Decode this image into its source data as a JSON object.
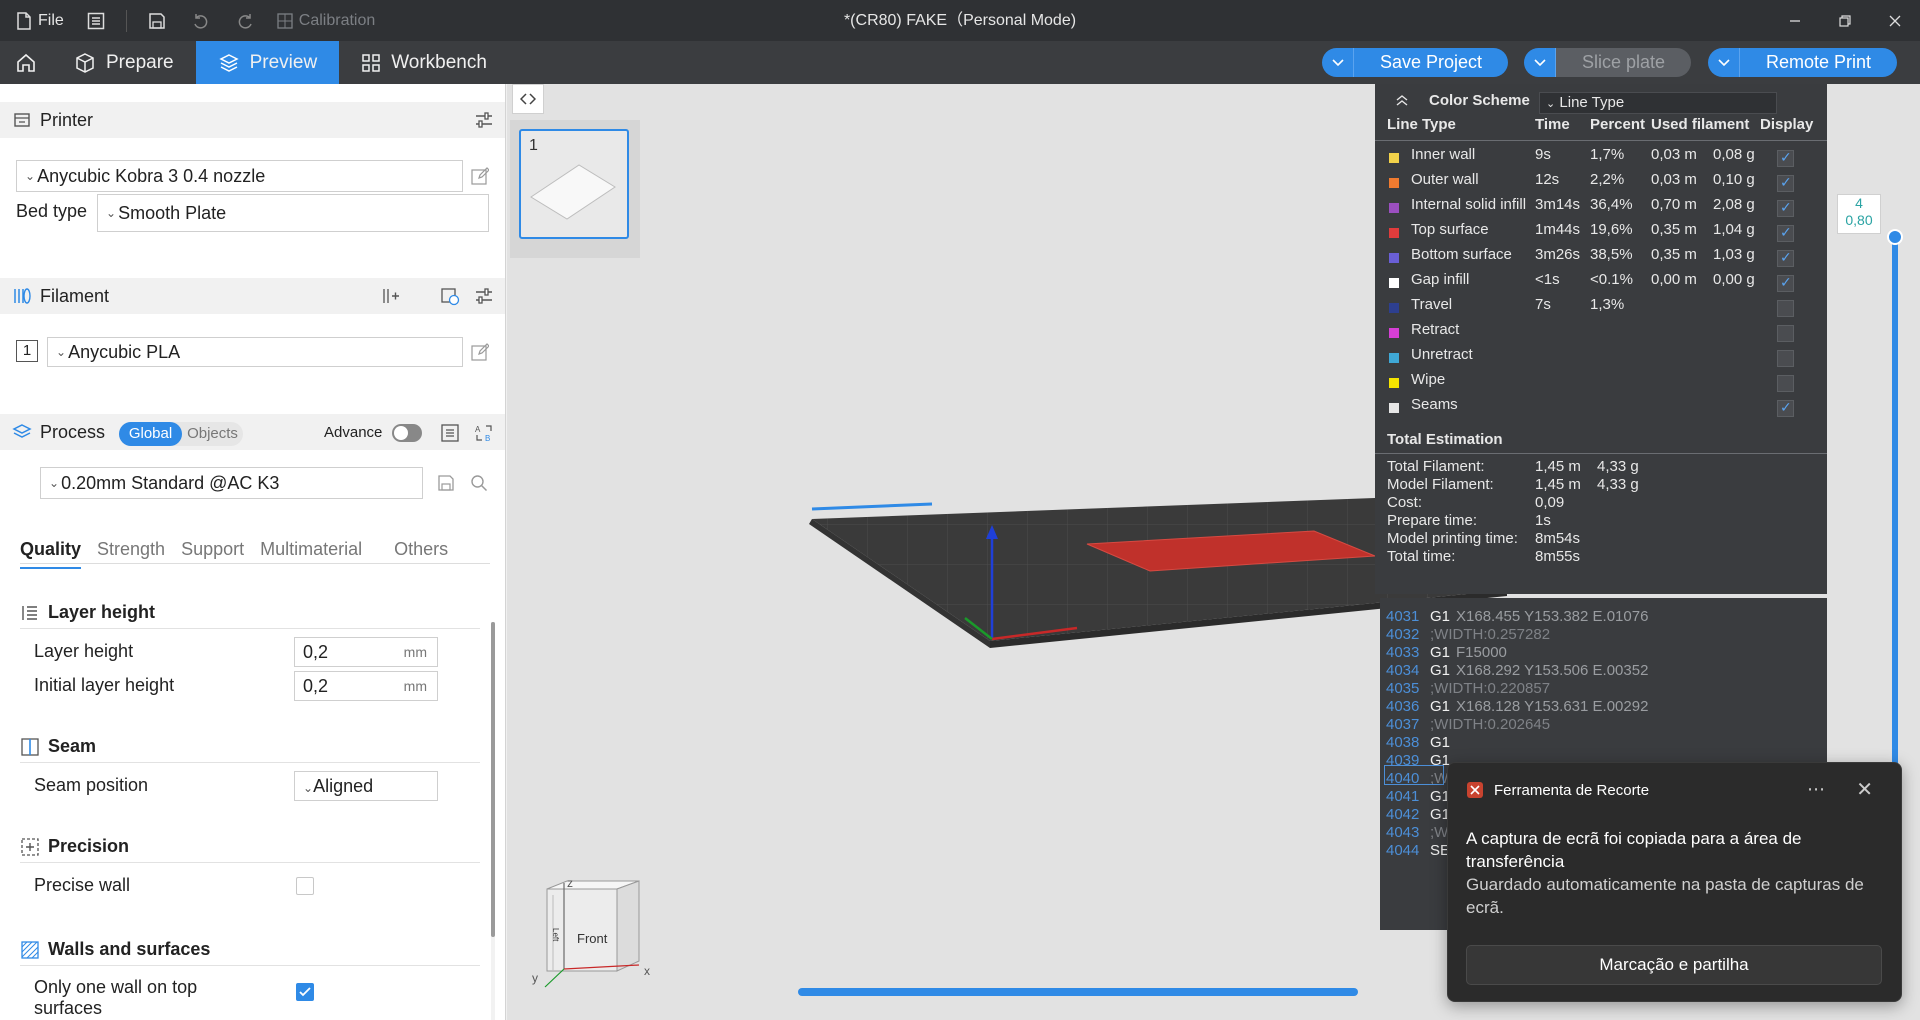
{
  "titlebar": {
    "file_label": "File",
    "calibration_label": "Calibration",
    "title": "*(CR80) FAKE（Personal Mode)"
  },
  "nav": {
    "tabs": [
      "Prepare",
      "Preview",
      "Workbench"
    ],
    "active_tab": "Preview",
    "save_project": "Save Project",
    "slice_plate": "Slice plate",
    "remote_print": "Remote Print"
  },
  "printer": {
    "section_title": "Printer",
    "printer_name": "Anycubic Kobra 3 0.4 nozzle",
    "bed_type_label": "Bed type",
    "bed_type_value": "Smooth Plate"
  },
  "filament": {
    "section_title": "Filament",
    "slot_number": "1",
    "filament_name": "Anycubic PLA"
  },
  "process": {
    "section_title": "Process",
    "toggle_global": "Global",
    "toggle_objects": "Objects",
    "advance_label": "Advance",
    "preset": "0.20mm Standard @AC K3",
    "tabs": [
      "Quality",
      "Strength",
      "Support",
      "Multimaterial",
      "Others"
    ],
    "active_tab": "Quality",
    "groups": {
      "layer_height_title": "Layer height",
      "layer_height_label": "Layer height",
      "layer_height_value": "0,2",
      "initial_layer_height_label": "Initial layer height",
      "initial_layer_height_value": "0,2",
      "unit": "mm",
      "seam_title": "Seam",
      "seam_position_label": "Seam position",
      "seam_position_value": "Aligned",
      "precision_title": "Precision",
      "precise_wall_label": "Precise wall",
      "precise_wall_checked": false,
      "walls_title": "Walls and surfaces",
      "only_one_wall_label_line1": "Only one wall on top",
      "only_one_wall_label_line2": "surfaces",
      "only_one_wall_checked": true
    }
  },
  "plate": {
    "number": "1"
  },
  "view_cube": {
    "front": "Front",
    "left": "Left",
    "axis_z": "z",
    "axis_y": "y",
    "axis_x": "x"
  },
  "layer_slider": {
    "top_layer": "4",
    "top_height": "0,80"
  },
  "legend": {
    "color_scheme_label": "Color Scheme",
    "color_scheme_value": "Line Type",
    "headers": {
      "line_type": "Line Type",
      "time": "Time",
      "percent": "Percent",
      "used_filament": "Used filament",
      "display": "Display"
    },
    "rows": [
      {
        "name": "Inner wall",
        "color": "#f2d24a",
        "time": "9s",
        "percent": "1,7%",
        "meters": "0,03 m",
        "grams": "0,08 g",
        "display": true
      },
      {
        "name": "Outer wall",
        "color": "#f07b30",
        "time": "12s",
        "percent": "2,2%",
        "meters": "0,03 m",
        "grams": "0,10 g",
        "display": true
      },
      {
        "name": "Internal solid infill",
        "color": "#9b4fc0",
        "time": "3m14s",
        "percent": "36,4%",
        "meters": "0,70 m",
        "grams": "2,08 g",
        "display": true
      },
      {
        "name": "Top surface",
        "color": "#e03c3c",
        "time": "1m44s",
        "percent": "19,6%",
        "meters": "0,35 m",
        "grams": "1,04 g",
        "display": true
      },
      {
        "name": "Bottom surface",
        "color": "#6a5fd6",
        "time": "3m26s",
        "percent": "38,5%",
        "meters": "0,35 m",
        "grams": "1,03 g",
        "display": true
      },
      {
        "name": "Gap infill",
        "color": "#ffffff",
        "time": "<1s",
        "percent": "<0.1%",
        "meters": "0,00 m",
        "grams": "0,00 g",
        "display": true
      },
      {
        "name": "Travel",
        "color": "#2d3f8f",
        "time": "7s",
        "percent": "1,3%",
        "meters": "",
        "grams": "",
        "display": false
      },
      {
        "name": "Retract",
        "color": "#d63fd6",
        "time": "",
        "percent": "",
        "meters": "",
        "grams": "",
        "display": false
      },
      {
        "name": "Unretract",
        "color": "#3fa8d6",
        "time": "",
        "percent": "",
        "meters": "",
        "grams": "",
        "display": false
      },
      {
        "name": "Wipe",
        "color": "#f5e400",
        "time": "",
        "percent": "",
        "meters": "",
        "grams": "",
        "display": false
      },
      {
        "name": "Seams",
        "color": "#e6e6e6",
        "time": "",
        "percent": "",
        "meters": "",
        "grams": "",
        "display": true
      }
    ],
    "total_title": "Total Estimation",
    "totals": [
      {
        "label": "Total Filament:",
        "value": "1,45 m",
        "value2": "4,33 g"
      },
      {
        "label": "Model Filament:",
        "value": "1,45 m",
        "value2": "4,33 g"
      },
      {
        "label": "Cost:",
        "value": "0,09",
        "value2": ""
      },
      {
        "label": "Prepare time:",
        "value": "1s",
        "value2": ""
      },
      {
        "label": "Model printing time:",
        "value": "8m54s",
        "value2": ""
      },
      {
        "label": "Total time:",
        "value": "8m55s",
        "value2": ""
      }
    ]
  },
  "gcode": {
    "lines": [
      {
        "num": "4031",
        "cmd": "G1",
        "params": "X168.455 Y153.382 E.01076"
      },
      {
        "num": "4032",
        "cmd": "",
        "params": ";WIDTH:0.257282"
      },
      {
        "num": "4033",
        "cmd": "G1",
        "params": "F15000"
      },
      {
        "num": "4034",
        "cmd": "G1",
        "params": "X168.292 Y153.506 E.00352"
      },
      {
        "num": "4035",
        "cmd": "",
        "params": ";WIDTH:0.220857"
      },
      {
        "num": "4036",
        "cmd": "G1",
        "params": "X168.128 Y153.631 E.00292"
      },
      {
        "num": "4037",
        "cmd": "",
        "params": ";WIDTH:0.202645"
      },
      {
        "num": "4038",
        "cmd": "G1",
        "params": ""
      },
      {
        "num": "4039",
        "cmd": "G1",
        "params": ""
      },
      {
        "num": "4040",
        "cmd": "",
        "params": ";W"
      },
      {
        "num": "4041",
        "cmd": "G1",
        "params": ""
      },
      {
        "num": "4042",
        "cmd": "G1",
        "params": ""
      },
      {
        "num": "4043",
        "cmd": "",
        "params": ";W"
      },
      {
        "num": "4044",
        "cmd": "SE",
        "params": ""
      }
    ]
  },
  "notification": {
    "app_name": "Ferramenta de Recorte",
    "message": "A captura de ecrã foi copiada para a área de transferência",
    "detail": "Guardado automaticamente na pasta de capturas de ecrã.",
    "action": "Marcação e partilha"
  },
  "colors": {
    "accent": "#2f8ae6",
    "dark_bar": "#2f3134",
    "legend_bg": "#3a3c3f"
  }
}
